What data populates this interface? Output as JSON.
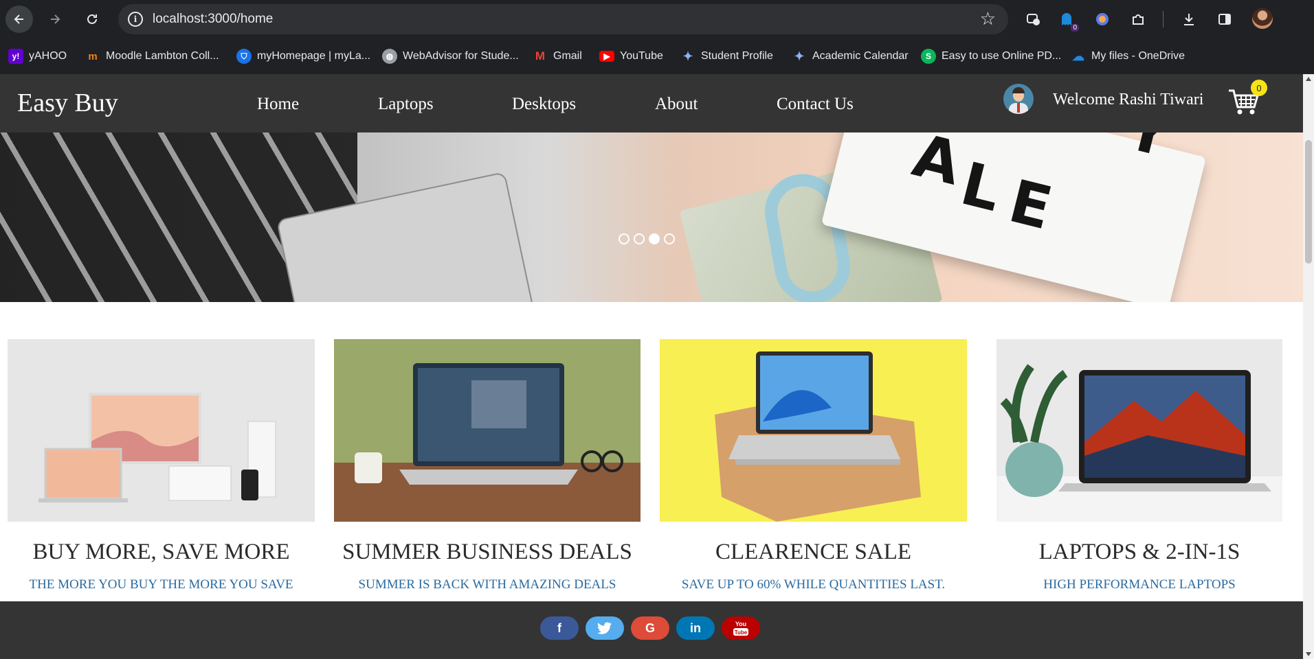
{
  "browser": {
    "url": "localhost:3000/home",
    "extension_badge": "0",
    "bookmarks": [
      {
        "label": "yAHOO",
        "icon": "yahoo-icon",
        "color": "#6001d2"
      },
      {
        "label": "Moodle Lambton Coll...",
        "icon": "moodle-icon",
        "color": "#f98012"
      },
      {
        "label": "myHomepage | myLa...",
        "icon": "shield-icon",
        "color": "#1a73e8"
      },
      {
        "label": "WebAdvisor for Stude...",
        "icon": "globe-icon",
        "color": "#9aa0a6"
      },
      {
        "label": "Gmail",
        "icon": "gmail-icon",
        "color": "#ea4335"
      },
      {
        "label": "YouTube",
        "icon": "youtube-icon",
        "color": "#ff0000"
      },
      {
        "label": "Student Profile",
        "icon": "star-icon",
        "color": "#8ab4f8"
      },
      {
        "label": "Academic Calendar",
        "icon": "star-icon",
        "color": "#8ab4f8"
      },
      {
        "label": "Easy to use Online PD...",
        "icon": "pdf-s-icon",
        "color": "#0ab65c"
      },
      {
        "label": "My files - OneDrive",
        "icon": "onedrive-icon",
        "color": "#1e88e5"
      }
    ]
  },
  "site": {
    "brand": "Easy Buy",
    "nav": [
      "Home",
      "Laptops",
      "Desktops",
      "About",
      "Contact Us"
    ],
    "welcome": "Welcome Rashi Tiwari",
    "cart_count": "0",
    "hero_letters": [
      "A",
      "L",
      "E",
      "Y"
    ],
    "carousel_total": 4,
    "carousel_active": 3
  },
  "cards": [
    {
      "title": "BUY MORE, SAVE MORE",
      "subtitle": "THE MORE YOU BUY THE MORE YOU SAVE"
    },
    {
      "title": "SUMMER BUSINESS DEALS",
      "subtitle": "SUMMER IS BACK WITH AMAZING DEALS"
    },
    {
      "title": "CLEARENCE SALE",
      "subtitle": "SAVE UP TO 60% WHILE QUANTITIES LAST."
    },
    {
      "title": "LAPTOPS & 2-IN-1S",
      "subtitle": "HIGH PERFORMANCE LAPTOPS"
    }
  ],
  "social": [
    {
      "label": "f",
      "color": "#3b5998",
      "icon": "facebook-icon"
    },
    {
      "label": "t",
      "color": "#55acee",
      "icon": "twitter-icon"
    },
    {
      "label": "G",
      "color": "#dd4b39",
      "icon": "google-icon"
    },
    {
      "label": "in",
      "color": "#0077b5",
      "icon": "linkedin-icon"
    },
    {
      "label": "You",
      "color": "#bb0000",
      "icon": "youtube-icon"
    }
  ]
}
